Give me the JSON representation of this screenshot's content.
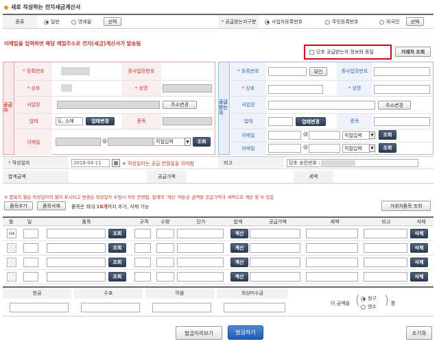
{
  "title": "새로 작성하는 전자세금계산서",
  "type_row": {
    "label": "종류",
    "options": [
      "일반",
      "영세율"
    ],
    "selected": "일반",
    "select_btn": "선택",
    "receiver_label": "공급받는자구분",
    "receiver_options": [
      "사업자등록번호",
      "주민등록번호",
      "외국인"
    ],
    "receiver_selected": "사업자등록번호",
    "receiver_btn": "선택"
  },
  "notice": "이메일을 입력하면 해당 메일주소로 전자(세금)계산서가 발송됨",
  "same_as_receiver": "당초 공급받는자 정보와 동일",
  "client_lookup_btn": "거래처 조회",
  "supplier": {
    "side_label": "공급자",
    "reg_no_label": "등록번호",
    "sub_biz_label": "종사업장번호",
    "company_label": "상호",
    "name_label": "성명",
    "address_label": "사업장",
    "address_btn": "주소변경",
    "biz_type_label": "업태",
    "biz_type_value": "도, 소매",
    "biz_type_btn": "업태변경",
    "item_label": "종목",
    "email_label": "이메일",
    "email_at": "@",
    "email_select": "직접입력",
    "email_btn": "조회"
  },
  "receiver": {
    "side_label": "공급받는자",
    "reg_no_label": "등록번호",
    "confirm_btn": "확인",
    "sub_biz_label": "종사업장번호",
    "company_label": "상호",
    "name_label": "성명",
    "address_label": "사업장",
    "address_btn": "주소변경",
    "biz_type_label": "업태",
    "biz_type_btn": "업태변경",
    "item_label": "종목",
    "email1_label": "이메일",
    "email2_label": "이메일",
    "email_at": "@",
    "email_select": "직접입력",
    "email_btn": "조회"
  },
  "date_row": {
    "label": "작성일자",
    "value": "2018-04-11",
    "note": "※ 작성일자는 공급 연월일을 의미함",
    "remark_label": "비고",
    "remark_value": "당초 승인번호 :"
  },
  "totals_row": {
    "total_label": "합계금액",
    "supply_label": "공급가액",
    "tax_label": "세액"
  },
  "item_notice": "※ 품목의 월은 작성일자의 월이 표시되고 변경은 작성일자 수정시 자동 반영됨, 합계의 '계산' 버튼은 금액을 공급가액과 세액으로 계산 할 수 있음",
  "item_controls": {
    "add_btn": "품목추가",
    "del_btn": "품목삭제",
    "note_prefix": "품목은 최대 ",
    "note_max": "16개",
    "note_suffix": "까지 추가, 삭제 가능",
    "client_item_btn": "거래처품목 조회"
  },
  "item_table": {
    "headers": [
      "월",
      "일",
      "품목",
      "규격",
      "수량",
      "단가",
      "합계",
      "공급가액",
      "세액",
      "비고",
      "삭제"
    ],
    "rows": [
      {
        "month": "04",
        "lookup": "조회",
        "calc": "계산",
        "delete": "삭제"
      },
      {
        "month": "",
        "lookup": "조회",
        "calc": "계산",
        "delete": "삭제"
      },
      {
        "month": "",
        "lookup": "조회",
        "calc": "계산",
        "delete": "삭제"
      },
      {
        "month": "",
        "lookup": "조회",
        "calc": "계산",
        "delete": "삭제"
      }
    ]
  },
  "payment": {
    "headers": [
      "현금",
      "수표",
      "어음",
      "외상미수금"
    ],
    "prefix": "이 금액을",
    "options": [
      "청구",
      "영수"
    ],
    "selected": "청구",
    "suffix": "함"
  },
  "footer": {
    "preview_btn": "발급미리보기",
    "issue_btn": "발급하기",
    "reset_btn": "초기화"
  },
  "colors": {
    "highlight_border": "#d0021b",
    "supplier_accent": "#c0392b",
    "receiver_accent": "#3a66b0",
    "issue_button": "#1e5cb3"
  }
}
